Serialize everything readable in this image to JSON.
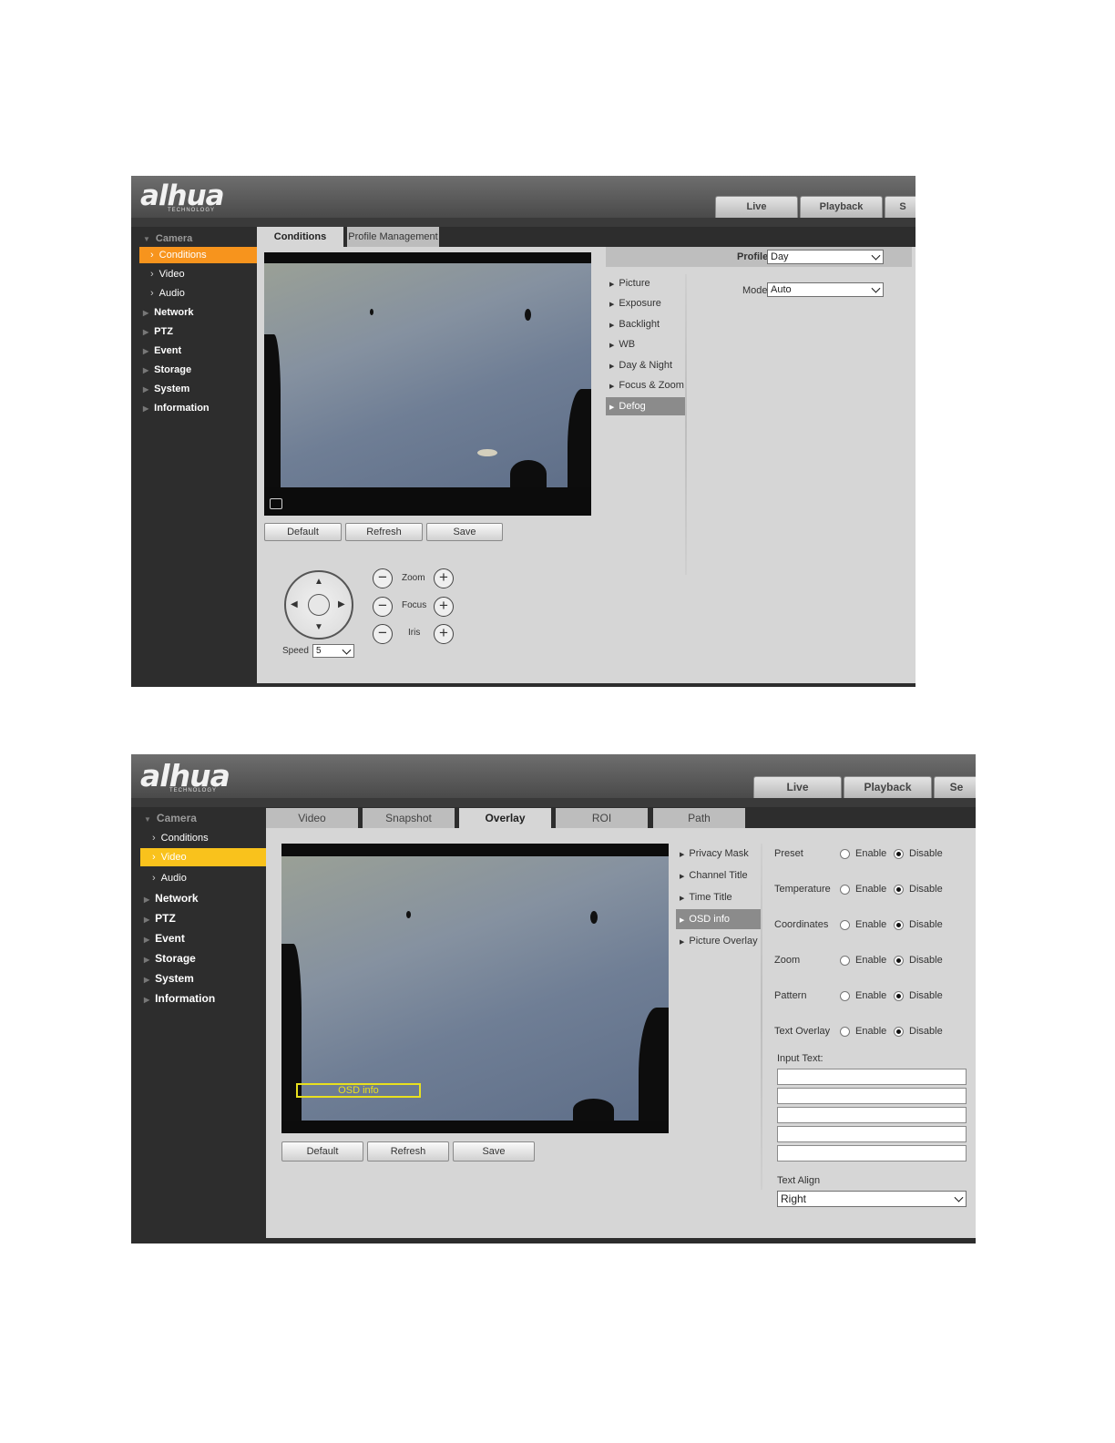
{
  "screen1": {
    "logo_text": "alhua",
    "logo_sub": "TECHNOLOGY",
    "top_tabs": [
      "Live",
      "Playback",
      "S"
    ],
    "sidebar": {
      "head": "Camera",
      "items": [
        "Conditions",
        "Video",
        "Audio",
        "Network",
        "PTZ",
        "Event",
        "Storage",
        "System",
        "Information"
      ],
      "active": "Conditions"
    },
    "subtabs": [
      "Conditions",
      "Profile Management"
    ],
    "buttons": [
      "Default",
      "Refresh",
      "Save"
    ],
    "profile_label": "Profile",
    "profile_value": "Day",
    "menu": [
      "Picture",
      "Exposure",
      "Backlight",
      "WB",
      "Day & Night",
      "Focus & Zoom",
      "Defog"
    ],
    "menu_active": "Defog",
    "mode_label": "Mode",
    "mode_value": "Auto",
    "ptz": {
      "zoom": "Zoom",
      "focus": "Focus",
      "iris": "Iris",
      "speed_label": "Speed",
      "speed_value": "5",
      "minus": "−",
      "plus": "+"
    },
    "icons": [
      "fullscreen-icon",
      "arrow-up-icon",
      "arrow-down-icon",
      "arrow-left-icon",
      "arrow-right-icon"
    ]
  },
  "screen2": {
    "logo_text": "alhua",
    "logo_sub": "TECHNOLOGY",
    "top_tabs": [
      "Live",
      "Playback",
      "Se"
    ],
    "sidebar": {
      "head": "Camera",
      "items": [
        "Conditions",
        "Video",
        "Audio",
        "Network",
        "PTZ",
        "Event",
        "Storage",
        "System",
        "Information"
      ],
      "active": "Video"
    },
    "subtabs": [
      "Video",
      "Snapshot",
      "Overlay",
      "ROI",
      "Path"
    ],
    "active_subtab": "Overlay",
    "osd_overlay_text": "OSD info",
    "buttons": [
      "Default",
      "Refresh",
      "Save"
    ],
    "menu": [
      "Privacy Mask",
      "Channel Title",
      "Time Title",
      "OSD info",
      "Picture Overlay"
    ],
    "menu_active": "OSD info",
    "settings": [
      {
        "label": "Preset",
        "enable": "Enable",
        "disable": "Disable",
        "selected": "Disable"
      },
      {
        "label": "Temperature",
        "enable": "Enable",
        "disable": "Disable",
        "selected": "Disable"
      },
      {
        "label": "Coordinates",
        "enable": "Enable",
        "disable": "Disable",
        "selected": "Disable"
      },
      {
        "label": "Zoom",
        "enable": "Enable",
        "disable": "Disable",
        "selected": "Disable"
      },
      {
        "label": "Pattern",
        "enable": "Enable",
        "disable": "Disable",
        "selected": "Disable"
      },
      {
        "label": "Text Overlay",
        "enable": "Enable",
        "disable": "Disable",
        "selected": "Disable"
      }
    ],
    "input_text_label": "Input Text:",
    "input_text_values": [
      "",
      "",
      "",
      "",
      ""
    ],
    "text_align_label": "Text Align",
    "text_align_value": "Right"
  },
  "colors": {
    "active_orange": "#f7941d",
    "active_yellow": "#f9c21c",
    "sidebar_bg": "#2d2d2d",
    "content_bg": "#d6d6d6",
    "osd_box": "#e8e01f"
  }
}
